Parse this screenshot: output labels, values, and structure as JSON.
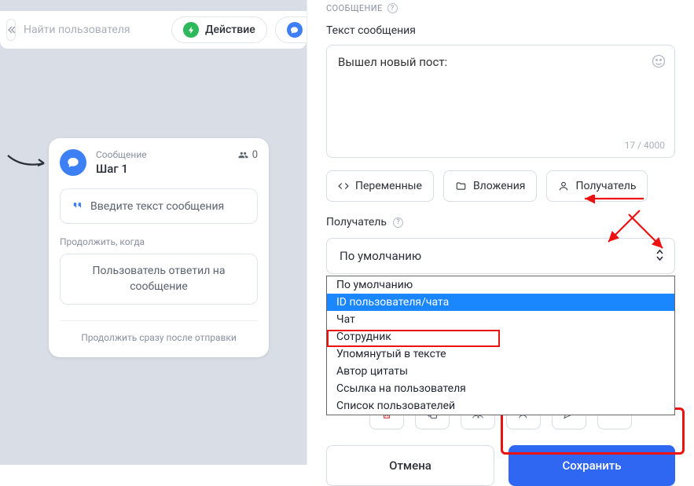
{
  "topbar": {
    "search_placeholder": "Найти пользователя",
    "action_label": "Действие",
    "message_label": "Сооб"
  },
  "node": {
    "subtitle": "Сообщение",
    "title": "Шаг 1",
    "count": "0",
    "placeholder_text": "Введите текст сообщения",
    "continue_label": "Продолжить, когда",
    "continue_text": "Пользователь ответил на сообщение",
    "footer_text": "Продолжить сразу после отправки"
  },
  "panel": {
    "section_label": "СООБЩЕНИЕ",
    "text_label": "Текст сообщения",
    "textarea_value": "Вышел новый пост:",
    "char_count": "17 / 4000",
    "btn_vars": "Переменные",
    "btn_attach": "Вложения",
    "btn_recipient": "Получатель",
    "recipient_label": "Получатель",
    "select_value": "По умолчанию",
    "dropdown": [
      "По умолчанию",
      "ID пользователя/чата",
      "Чат",
      "Сотрудник",
      "Упомянутый в тексте",
      "Автор цитаты",
      "Ссылка на пользователя",
      "Список пользователей"
    ],
    "cancel_label": "Отмена",
    "save_label": "Сохранить"
  }
}
